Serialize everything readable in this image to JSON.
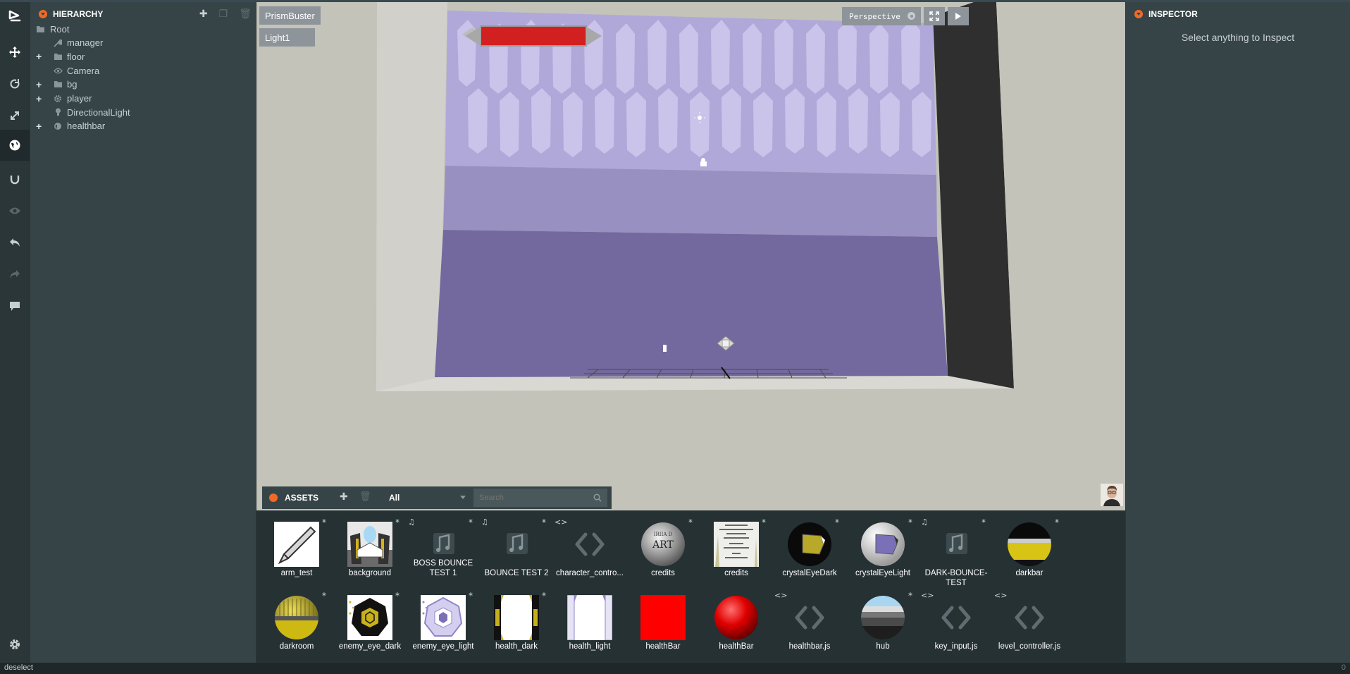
{
  "hierarchy": {
    "title": "HIERARCHY",
    "items": [
      {
        "label": "Root",
        "icon": "folder-icon",
        "expandable": false
      },
      {
        "label": "manager",
        "icon": "wrench-icon",
        "expandable": false
      },
      {
        "label": "floor",
        "icon": "folder-icon",
        "expandable": true
      },
      {
        "label": "Camera",
        "icon": "eye-icon",
        "expandable": false
      },
      {
        "label": "bg",
        "icon": "folder-icon",
        "expandable": true
      },
      {
        "label": "player",
        "icon": "gear-icon",
        "expandable": true
      },
      {
        "label": "DirectionalLight",
        "icon": "lightbulb-icon",
        "expandable": false
      },
      {
        "label": "healthbar",
        "icon": "globe-icon",
        "expandable": true
      }
    ]
  },
  "viewport": {
    "tabs": [
      "PrismBuster",
      "Light1"
    ],
    "camera_mode": "Perspective"
  },
  "inspector": {
    "title": "INSPECTOR",
    "empty_message": "Select anything to Inspect"
  },
  "assets": {
    "title": "ASSETS",
    "filter": "All",
    "search_placeholder": "Search",
    "items": [
      {
        "label": "arm_test",
        "kind": "texture-blade",
        "star": true,
        "badge": ""
      },
      {
        "label": "background",
        "kind": "texture-bg",
        "star": true,
        "badge": ""
      },
      {
        "label": "BOSS BOUNCE TEST 1",
        "kind": "audio",
        "star": true,
        "badge": "♫"
      },
      {
        "label": "BOUNCE TEST 2",
        "kind": "audio",
        "star": true,
        "badge": "♫"
      },
      {
        "label": "character_contro...",
        "kind": "script",
        "star": false,
        "badge": "<>"
      },
      {
        "label": "credits",
        "kind": "material-credits",
        "star": true,
        "badge": ""
      },
      {
        "label": "credits",
        "kind": "texture-credits",
        "star": true,
        "badge": ""
      },
      {
        "label": "crystalEyeDark",
        "kind": "material-eye-dark",
        "star": true,
        "badge": ""
      },
      {
        "label": "crystalEyeLight",
        "kind": "material-eye-light",
        "star": true,
        "badge": ""
      },
      {
        "label": "DARK-BOUNCE-TEST",
        "kind": "audio",
        "star": true,
        "badge": "♫"
      },
      {
        "label": "darkbar",
        "kind": "material-darkbar",
        "star": true,
        "badge": ""
      },
      {
        "label": "darkroom",
        "kind": "material-darkroom",
        "star": true,
        "badge": ""
      },
      {
        "label": "enemy_eye_dark",
        "kind": "texture-eye-dark",
        "star": true,
        "badge": ""
      },
      {
        "label": "enemy_eye_light",
        "kind": "texture-eye-light",
        "star": true,
        "badge": ""
      },
      {
        "label": "health_dark",
        "kind": "texture-health-dark",
        "star": true,
        "badge": ""
      },
      {
        "label": "health_light",
        "kind": "texture-health-light",
        "star": false,
        "badge": ""
      },
      {
        "label": "healthBar",
        "kind": "texture-red",
        "star": false,
        "badge": ""
      },
      {
        "label": "healthBar",
        "kind": "material-red",
        "star": false,
        "badge": ""
      },
      {
        "label": "healthbar.js",
        "kind": "script",
        "star": false,
        "badge": "<>"
      },
      {
        "label": "hub",
        "kind": "material-hub",
        "star": true,
        "badge": ""
      },
      {
        "label": "key_input.js",
        "kind": "script",
        "star": false,
        "badge": "<>"
      },
      {
        "label": "level_controller.js",
        "kind": "script",
        "star": false,
        "badge": "<>"
      }
    ]
  },
  "status": {
    "left": "deselect",
    "right": "0"
  },
  "colors": {
    "accent": "#f06a26",
    "panel": "#364447",
    "toolbar": "#2b3639",
    "viewport_bg": "#c4c3b9",
    "room_purple": "#74699e"
  }
}
